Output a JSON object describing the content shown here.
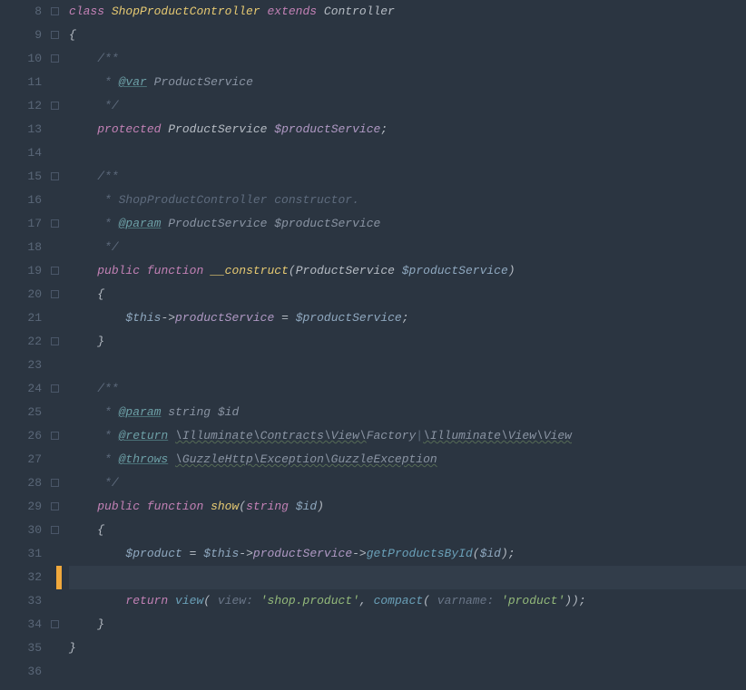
{
  "first_line_number": 8,
  "cursor_line_index": 24,
  "lines": [
    {
      "html": "<span class='kw'>class</span> <span class='type'>ShopProductController</span> <span class='kw'>extends</span> <span class='ident'>Controller</span>"
    },
    {
      "html": "<span class='punct'>{</span>"
    },
    {
      "html": "    <span class='comment'>/**</span>"
    },
    {
      "html": "    <span class='comment'> * </span><span class='doc-tag'>@var</span><span class='comment'> </span><span class='doc-type'>ProductService</span>"
    },
    {
      "html": "    <span class='comment'> */</span>"
    },
    {
      "html": "    <span class='kw'>protected</span> <span class='ident'>ProductService</span> <span class='prop'>$productService</span><span class='punct'>;</span>"
    },
    {
      "html": ""
    },
    {
      "html": "    <span class='comment'>/**</span>"
    },
    {
      "html": "    <span class='comment'> * ShopProductController constructor.</span>"
    },
    {
      "html": "    <span class='comment'> * </span><span class='doc-tag'>@param</span><span class='comment'> </span><span class='doc-type'>ProductService</span><span class='comment'> </span><span class='doc-type'>$productService</span>"
    },
    {
      "html": "    <span class='comment'> */</span>"
    },
    {
      "html": "    <span class='kw'>public</span> <span class='kw'>function</span> <span class='fn'>__construct</span><span class='punct'>(</span><span class='ident'>ProductService</span> <span class='var'>$productService</span><span class='punct'>)</span>"
    },
    {
      "html": "    <span class='punct'>{</span>"
    },
    {
      "html": "        <span class='var'>$this</span><span class='op'>-></span><span class='prop'>productService</span> <span class='op'>=</span> <span class='var'>$productService</span><span class='punct'>;</span>"
    },
    {
      "html": "    <span class='punct'>}</span>"
    },
    {
      "html": ""
    },
    {
      "html": "    <span class='comment'>/**</span>"
    },
    {
      "html": "    <span class='comment'> * </span><span class='doc-tag'>@param</span><span class='comment'> </span><span class='doc-type'>string</span><span class='comment'> </span><span class='doc-type'>$id</span>"
    },
    {
      "html": "    <span class='comment'> * </span><span class='doc-tag'>@return</span><span class='comment'> </span><span class='wavy doc-type'>\\Illuminate\\Contracts\\View\\</span><span class='doc-type'>Factory</span><span class='comment'>|</span><span class='wavy doc-type'>\\Illuminate\\View\\View</span>"
    },
    {
      "html": "    <span class='comment'> * </span><span class='doc-tag'>@throws</span><span class='comment'> </span><span class='wavy doc-type'>\\GuzzleHttp\\Exception\\GuzzleException</span>"
    },
    {
      "html": "    <span class='comment'> */</span>"
    },
    {
      "html": "    <span class='kw'>public</span> <span class='kw'>function</span> <span class='fn'>show</span><span class='punct'>(</span><span class='kw'>string</span> <span class='var'>$id</span><span class='punct'>)</span>"
    },
    {
      "html": "    <span class='punct'>{</span>"
    },
    {
      "html": "        <span class='var'>$product</span> <span class='op'>=</span> <span class='var'>$this</span><span class='op'>-></span><span class='prop'>productService</span><span class='op'>-></span><span class='fn-call'>getProductsById</span><span class='punct'>(</span><span class='var'>$id</span><span class='punct'>);</span>"
    },
    {
      "html": ""
    },
    {
      "html": "        <span class='kw'>return</span> <span class='fn-call'>view</span><span class='punct'>(</span> <span class='param-hint'>view:</span> <span class='str'>'shop.product'</span><span class='punct'>,</span> <span class='fn-call'>compact</span><span class='punct'>(</span> <span class='param-hint'>varname:</span> <span class='str'>'product'</span><span class='punct'>));</span>"
    },
    {
      "html": "    <span class='punct'>}</span>"
    },
    {
      "html": "<span class='punct'>}</span>"
    },
    {
      "html": ""
    }
  ],
  "fold_markers_at": [
    0,
    1,
    2,
    4,
    7,
    9,
    11,
    12,
    14,
    16,
    18,
    20,
    21,
    22,
    26
  ]
}
